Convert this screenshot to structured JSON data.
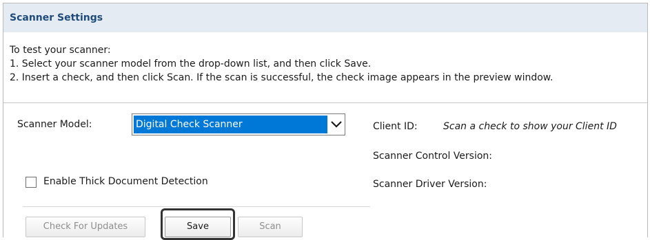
{
  "header": {
    "title": "Scanner Settings"
  },
  "instructions": {
    "intro": "To test your scanner:",
    "step1": "1. Select your scanner model from the drop-down list, and then click Save.",
    "step2": "2. Insert a check, and then click Scan. If the scan is successful, the check image appears in the preview window."
  },
  "scanner_model": {
    "label": "Scanner Model:",
    "selected": "Digital Check Scanner"
  },
  "thick_doc": {
    "label": "Enable Thick Document Detection",
    "checked": false
  },
  "info": {
    "client_id_label": "Client ID:",
    "client_id_value": "Scan a check to show your Client ID",
    "control_version_label": "Scanner Control Version:",
    "driver_version_label": "Scanner Driver Version:"
  },
  "buttons": {
    "check_updates": "Check For Updates",
    "save": "Save",
    "scan": "Scan"
  },
  "colors": {
    "header_bg": "#e4ebf3",
    "title": "#1f4b7c",
    "select_highlight": "#0078d7"
  }
}
